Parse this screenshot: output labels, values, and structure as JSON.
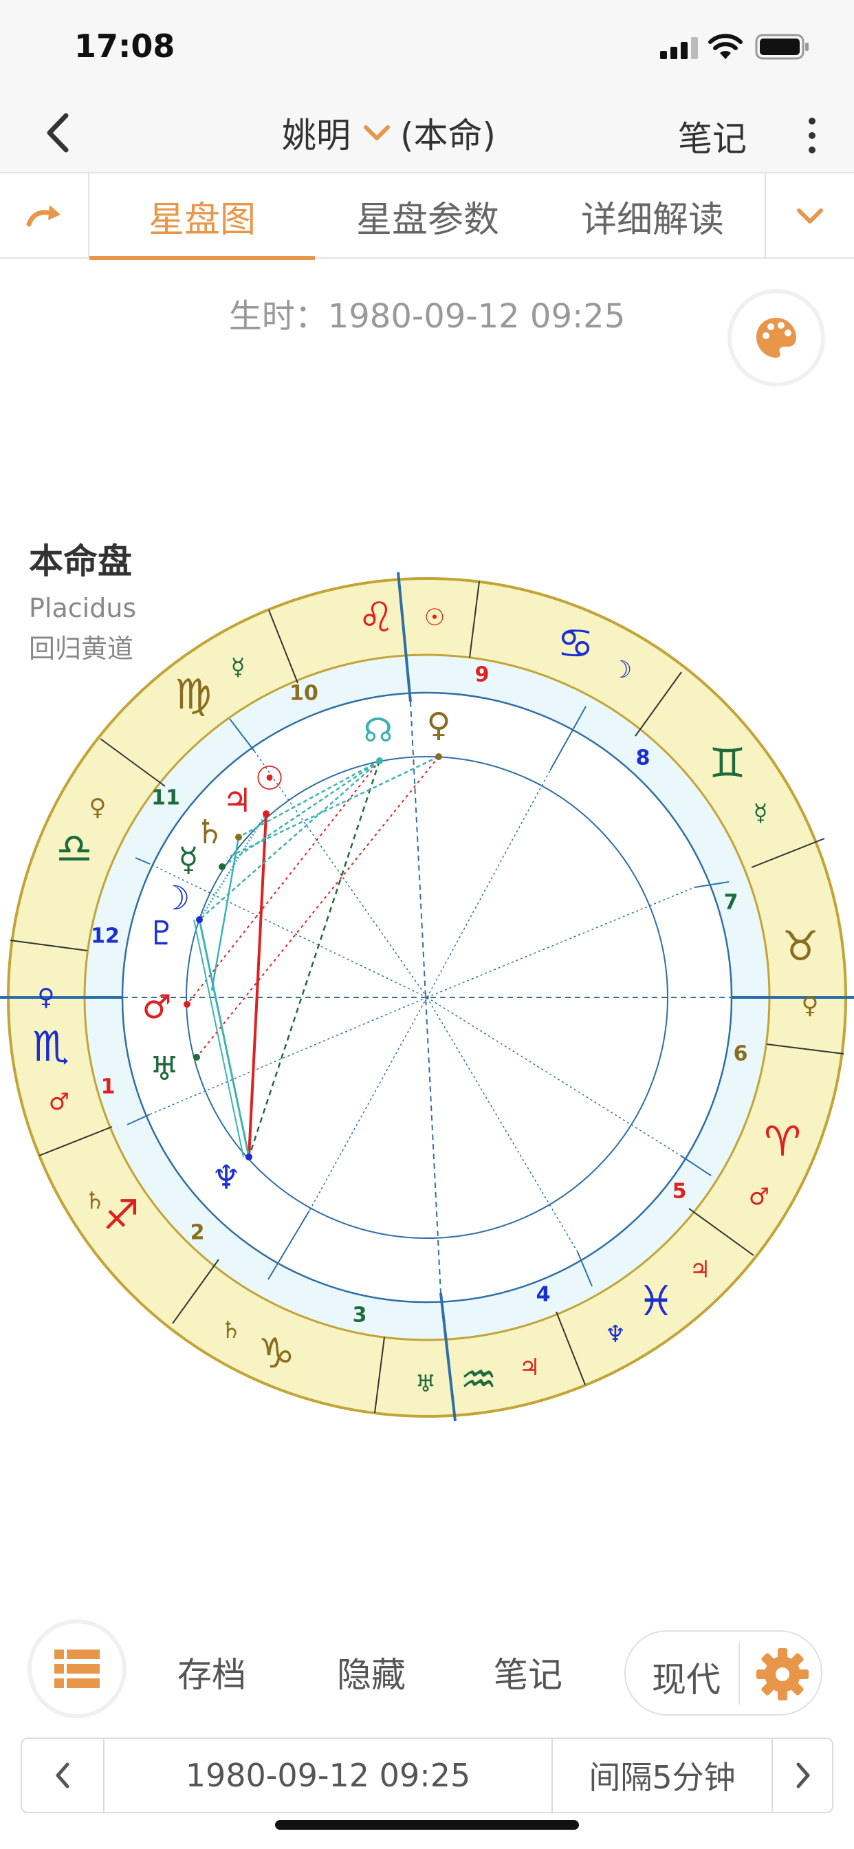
{
  "status_bar": {
    "time": "17:08"
  },
  "navbar": {
    "name": "姚明",
    "chart_kind": "(本命)",
    "notes_label": "笔记"
  },
  "tabs": [
    {
      "label": "星盘图",
      "active": true
    },
    {
      "label": "星盘参数",
      "active": false
    },
    {
      "label": "详细解读",
      "active": false
    }
  ],
  "birth_time": "生时：1980-09-12 09:25",
  "chart_info": {
    "title": "本命盘",
    "house_system": "Placidus",
    "zodiac": "回归黄道"
  },
  "colors": {
    "accent": "#e8964a",
    "ring": "#f8f3c2",
    "ring_border": "#c2a437",
    "house_ring": "#eaf8fc",
    "fire": "#e02020",
    "earth": "#1e6b3c",
    "air": "#8a6d1e",
    "water": "#1a2fd1",
    "axis": "#2f6ea6"
  },
  "signs": [
    {
      "name": "leo",
      "glyph": "♌",
      "element": "fire"
    },
    {
      "name": "cancer",
      "glyph": "♋",
      "element": "water"
    },
    {
      "name": "gemini",
      "glyph": "♊",
      "element": "earth"
    },
    {
      "name": "taurus",
      "glyph": "♉",
      "element": "air"
    },
    {
      "name": "aries",
      "glyph": "♈",
      "element": "fire"
    },
    {
      "name": "pisces",
      "glyph": "♓",
      "element": "water"
    },
    {
      "name": "aquarius",
      "glyph": "♒",
      "element": "earth"
    },
    {
      "name": "capricorn",
      "glyph": "♑",
      "element": "air"
    },
    {
      "name": "sagittarius",
      "glyph": "♐",
      "element": "fire"
    },
    {
      "name": "scorpio",
      "glyph": "♏",
      "element": "water"
    },
    {
      "name": "libra",
      "glyph": "♎",
      "element": "earth"
    },
    {
      "name": "virgo",
      "glyph": "♍",
      "element": "air"
    }
  ],
  "rulers": [
    {
      "glyph": "☉",
      "element": "fire"
    },
    {
      "glyph": "☽",
      "element": "water"
    },
    {
      "glyph": "☿",
      "element": "earth"
    },
    {
      "glyph": "♀",
      "element": "air"
    },
    {
      "glyph": "♂",
      "element": "fire"
    },
    {
      "glyph": "♃",
      "element": "fire"
    },
    {
      "glyph": "♆",
      "element": "water"
    },
    {
      "glyph": "♃",
      "element": "fire"
    },
    {
      "glyph": "♅",
      "element": "earth"
    },
    {
      "glyph": "♄",
      "element": "air"
    },
    {
      "glyph": "♄",
      "element": "air"
    },
    {
      "glyph": "♂",
      "element": "fire"
    },
    {
      "glyph": "♀",
      "element": "water"
    },
    {
      "glyph": "♀",
      "element": "air"
    },
    {
      "glyph": "☿",
      "element": "earth"
    }
  ],
  "houses": [
    {
      "num": "1",
      "element": "fire"
    },
    {
      "num": "2",
      "element": "air"
    },
    {
      "num": "3",
      "element": "earth"
    },
    {
      "num": "4",
      "element": "water"
    },
    {
      "num": "5",
      "element": "fire"
    },
    {
      "num": "6",
      "element": "air"
    },
    {
      "num": "7",
      "element": "earth"
    },
    {
      "num": "8",
      "element": "water"
    },
    {
      "num": "9",
      "element": "fire"
    },
    {
      "num": "10",
      "element": "air"
    },
    {
      "num": "11",
      "element": "earth"
    },
    {
      "num": "12",
      "element": "water"
    }
  ],
  "planets": [
    {
      "name": "sun",
      "glyph": "☉",
      "element": "fire"
    },
    {
      "name": "jupiter",
      "glyph": "♃",
      "element": "fire"
    },
    {
      "name": "saturn",
      "glyph": "♄",
      "element": "air"
    },
    {
      "name": "mercury",
      "glyph": "☿",
      "element": "earth"
    },
    {
      "name": "moon",
      "glyph": "☽",
      "element": "water"
    },
    {
      "name": "pluto",
      "glyph": "♇",
      "element": "water"
    },
    {
      "name": "mars",
      "glyph": "♂",
      "element": "fire"
    },
    {
      "name": "uranus",
      "glyph": "♅",
      "element": "earth"
    },
    {
      "name": "neptune",
      "glyph": "♆",
      "element": "water"
    },
    {
      "name": "north-node",
      "glyph": "☊",
      "element": "node"
    },
    {
      "name": "venus",
      "glyph": "♀",
      "element": "air"
    }
  ],
  "toolbar": {
    "archive": "存档",
    "hide": "隐藏",
    "notes": "笔记",
    "mode": "现代"
  },
  "datebar": {
    "date": "1980-09-12 09:25",
    "interval": "间隔5分钟"
  }
}
